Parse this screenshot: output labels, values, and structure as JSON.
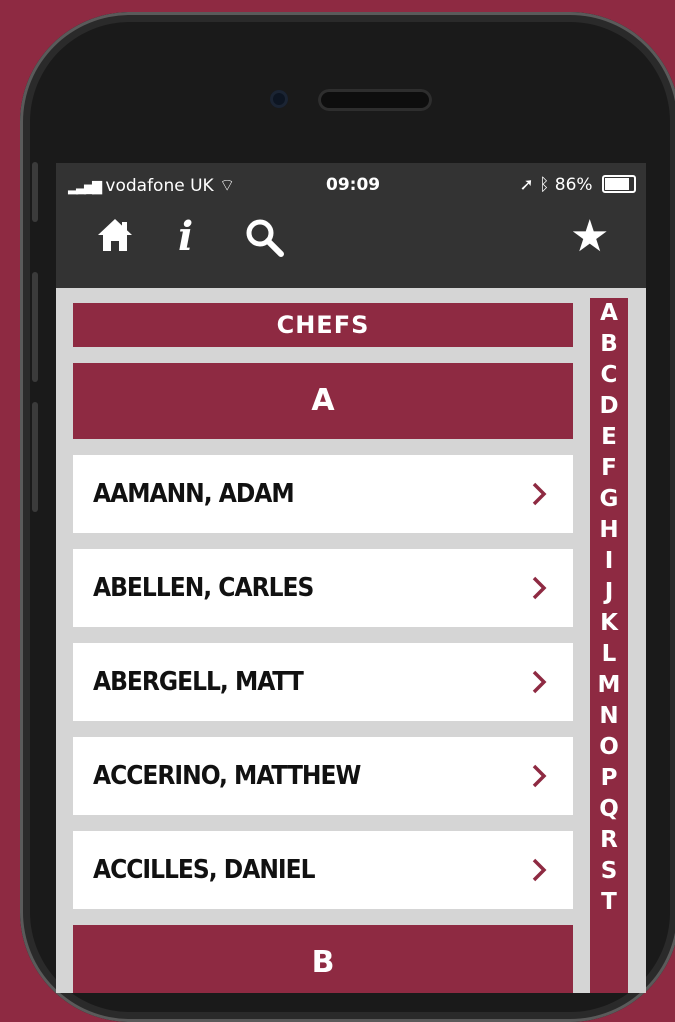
{
  "status_bar": {
    "carrier": "vodafone UK",
    "time": "09:09",
    "battery": "86%"
  },
  "header": {
    "home_icon": "home-icon",
    "info_label": "i",
    "search_icon": "search-icon",
    "favorites_icon": "star-icon"
  },
  "page": {
    "title": "CHEFS"
  },
  "sections": [
    {
      "letter": "A",
      "items": [
        {
          "name": "AAMANN, ADAM"
        },
        {
          "name": "ABELLEN, CARLES"
        },
        {
          "name": "ABERGELL, MATT"
        },
        {
          "name": "ACCERINO, MATTHEW"
        },
        {
          "name": "ACCILLES, DANIEL"
        }
      ]
    },
    {
      "letter": "B",
      "items": []
    }
  ],
  "alphabet_index": [
    "A",
    "B",
    "C",
    "D",
    "E",
    "F",
    "G",
    "H",
    "I",
    "J",
    "K",
    "L",
    "M",
    "N",
    "O",
    "P",
    "Q",
    "R",
    "S",
    "T"
  ],
  "colors": {
    "accent": "#8e2a42",
    "toolbar": "#333333",
    "background": "#d5d5d5"
  }
}
